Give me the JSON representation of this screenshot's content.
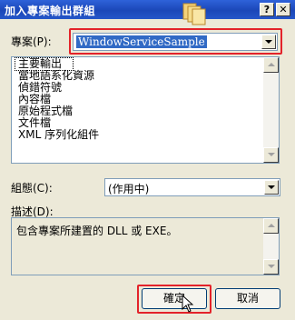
{
  "window": {
    "title": "加入專案輸出群組",
    "help_label": "?",
    "close_label": "✕",
    "icon": "documents-icon"
  },
  "project": {
    "label": "專案(P):",
    "value": "WindowServiceSample"
  },
  "outputs": {
    "items": [
      "主要輸出",
      "當地語系化資源",
      "偵錯符號",
      "內容檔",
      "原始程式檔",
      "文件檔",
      "XML 序列化組件"
    ],
    "selected_index": 0
  },
  "configuration": {
    "label": "組態(C):",
    "value": "(作用中)"
  },
  "description": {
    "label": "描述(D):",
    "text": "包含專案所建置的 DLL 或 EXE。"
  },
  "buttons": {
    "ok": "確定",
    "cancel": "取消"
  },
  "colors": {
    "highlight_box": "#e3232a",
    "titlebar": "#1b47b8",
    "selection": "#316ac5"
  }
}
